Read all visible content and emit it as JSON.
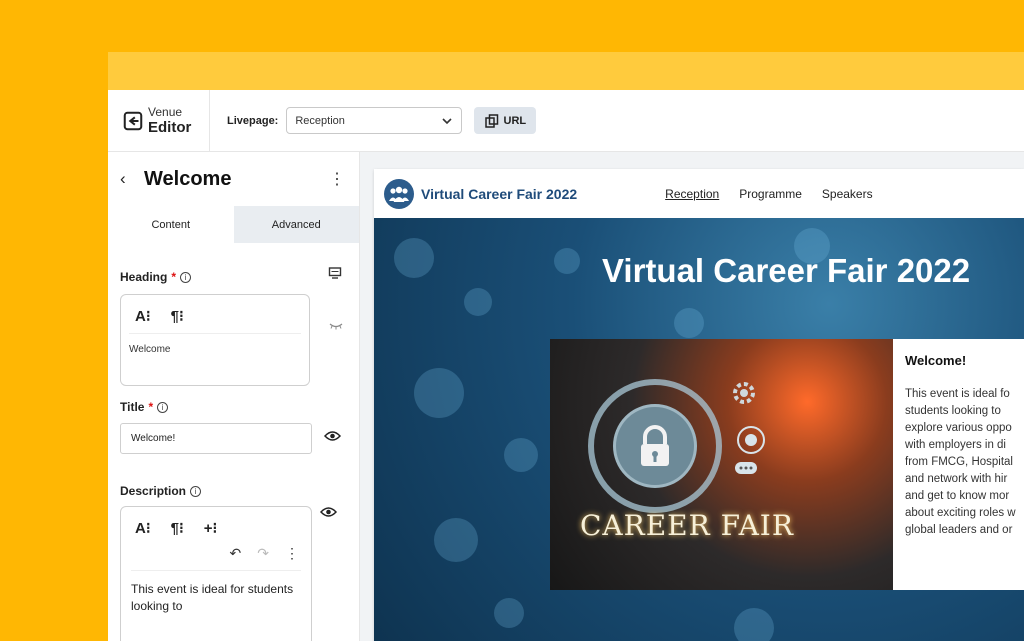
{
  "topbar": {
    "brand_small": "Venue",
    "brand_big": "Editor",
    "livepage_label": "Livepage:",
    "livepage_value": "Reception",
    "url_label": "URL"
  },
  "panel": {
    "title": "Welcome",
    "tabs": [
      "Content",
      "Advanced"
    ],
    "heading_label": "Heading",
    "heading_value": "Welcome",
    "title_label": "Title",
    "title_value": "Welcome!",
    "description_label": "Description",
    "description_text": "This event is ideal for students looking to"
  },
  "preview": {
    "site_name": "Virtual Career Fair 2022",
    "nav": [
      "Reception",
      "Programme",
      "Speakers"
    ],
    "hero_title": "Virtual Career Fair 2022",
    "image_text": "CAREER FAIR",
    "card_heading": "Welcome!",
    "card_body": "This event is ideal fo\nstudents looking to\nexplore various oppo\nwith employers  in di\nfrom FMCG, Hospital\nand network with hir\nand get to know mor\nabout exciting roles w\nglobal leaders and or"
  },
  "colors": {
    "background": "#FFB703",
    "titlebar": "#FFCB3D",
    "brand_blue": "#1f4b7a",
    "required": "#dd1111"
  }
}
